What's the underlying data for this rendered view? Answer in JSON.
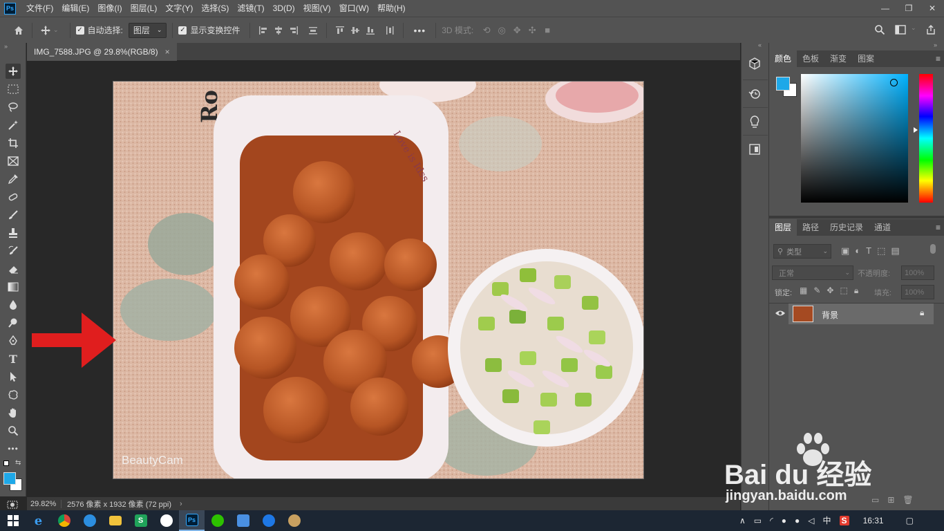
{
  "menu": [
    "文件(F)",
    "编辑(E)",
    "图像(I)",
    "图层(L)",
    "文字(Y)",
    "选择(S)",
    "滤镜(T)",
    "3D(D)",
    "视图(V)",
    "窗口(W)",
    "帮助(H)"
  ],
  "window_controls": [
    "—",
    "❐",
    "✕"
  ],
  "options": {
    "auto_select_label": "自动选择:",
    "auto_select_target": "图层",
    "show_transform_label": "显示变换控件",
    "mode3d_label": "3D 模式:",
    "more": "•••"
  },
  "document": {
    "tab_title": "IMG_7588.JPG @ 29.8%(RGB/8)",
    "close": "×",
    "zoom": "29.82%",
    "dimensions": "2576 像素 x 1932 像素 (72 ppi)",
    "watermark": "BeautyCam",
    "bowl_text": "Love is Idss"
  },
  "color_panel": {
    "tabs": [
      "颜色",
      "色板",
      "渐变",
      "图案"
    ],
    "foreground": "#1ea8e8",
    "background": "#ffffff"
  },
  "layers_panel": {
    "tabs": [
      "图层",
      "路径",
      "历史记录",
      "通道"
    ],
    "filter_placeholder": "类型",
    "blend_mode": "正常",
    "opacity_label": "不透明度:",
    "opacity_value": "100%",
    "lock_label": "锁定:",
    "fill_label": "填充:",
    "fill_value": "100%",
    "layers": [
      {
        "name": "背景",
        "visible": true,
        "locked": true
      }
    ]
  },
  "taskbar": {
    "time": "16:31",
    "ime": "中"
  },
  "overlay": {
    "site_logo": "Bai du 经验",
    "site_url": "jingyan.baidu.com"
  },
  "colors": {
    "accent": "#1ea8e8",
    "arrow": "#e01e1e"
  }
}
